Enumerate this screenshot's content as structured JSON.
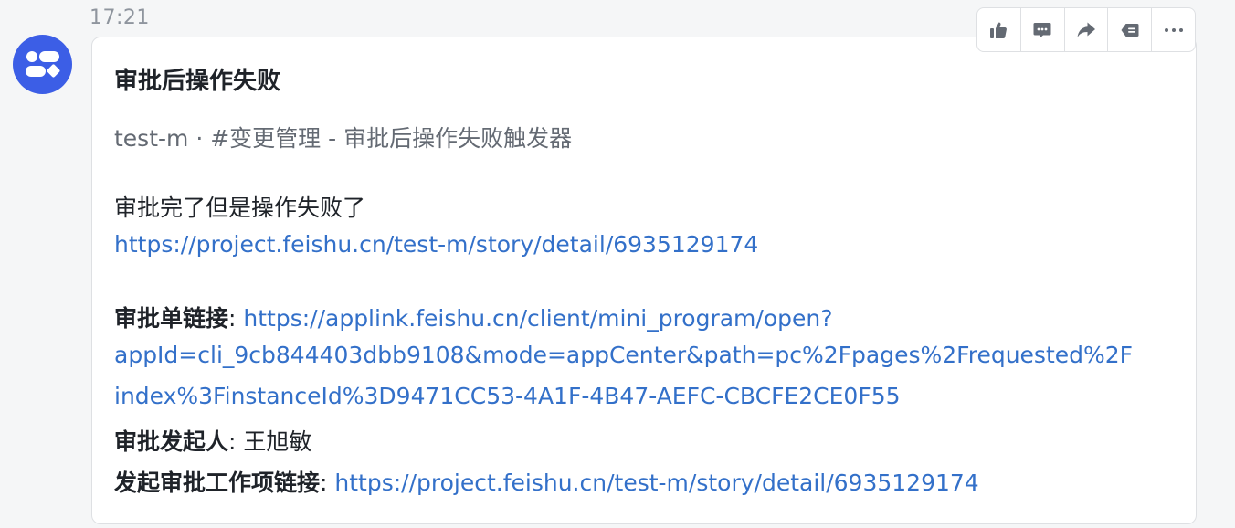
{
  "message": {
    "time": "17:21",
    "avatar_icon": "bot-avatar-icon",
    "card": {
      "title": "审批后操作失败",
      "subtitle": "test-m · #变更管理 - 审批后操作失败触发器",
      "body_text": "审批完了但是操作失败了",
      "story_link": "https://project.feishu.cn/test-m/story/detail/6935129174",
      "approval_label": "审批单链接",
      "approval_link_line1": "https://applink.feishu.cn/client/mini_program/open?",
      "approval_link_line2": "appId=cli_9cb844403dbb9108&mode=appCenter&path=pc%2Fpages%2Frequested%2F",
      "approval_link_line3": "index%3FinstanceId%3D9471CC53-4A1F-4B47-AEFC-CBCFE2CE0F55",
      "initiator_label": "审批发起人",
      "initiator_name": "王旭敏",
      "workitem_label": "发起审批工作项链接",
      "workitem_link": "https://project.feishu.cn/test-m/story/detail/6935129174",
      "separator": ": "
    }
  },
  "toolbar": {
    "icons": [
      "thumbs-up-icon",
      "comment-icon",
      "forward-icon",
      "quote-reply-icon",
      "more-icon"
    ]
  },
  "colors": {
    "link": "#3370c9",
    "avatar": "#3c5ee6",
    "icon": "#646a73"
  }
}
